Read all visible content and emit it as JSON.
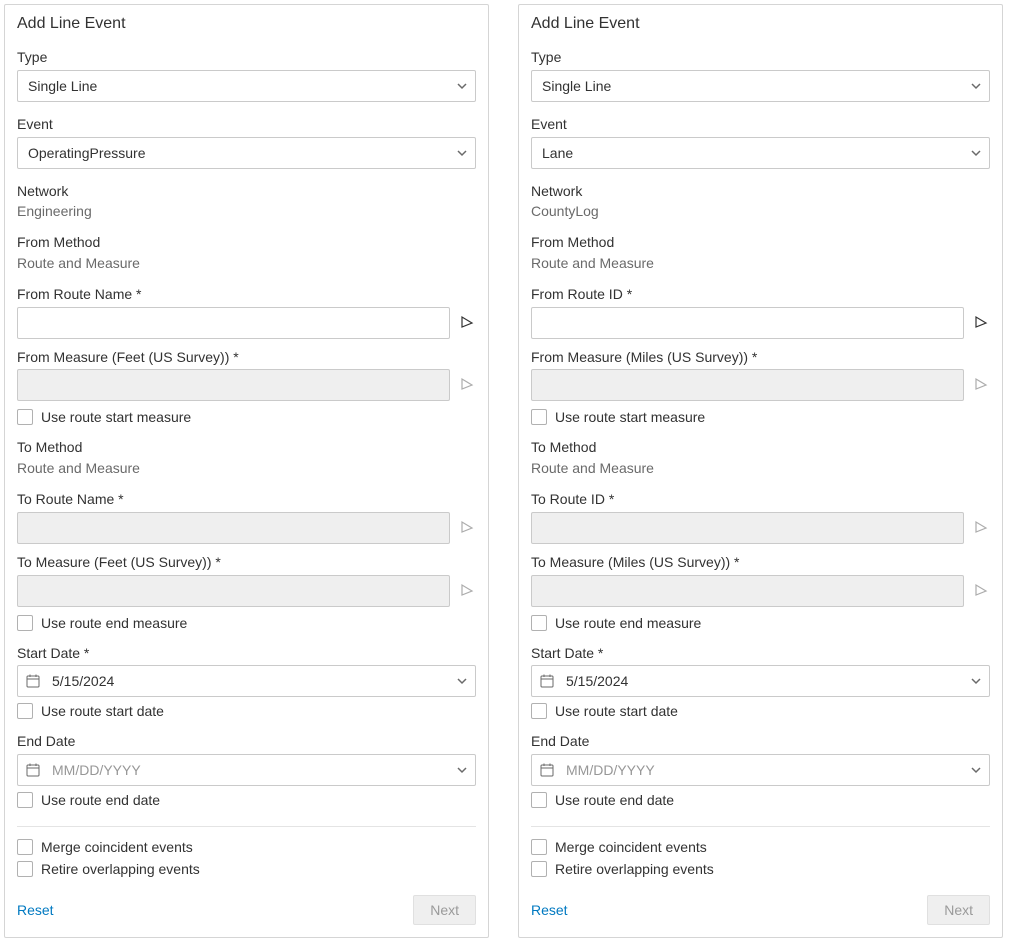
{
  "panels": [
    {
      "title": "Add Line Event",
      "type_label": "Type",
      "type_value": "Single Line",
      "event_label": "Event",
      "event_value": "OperatingPressure",
      "network_label": "Network",
      "network_value": "Engineering",
      "from_method_label": "From Method",
      "from_method_value": "Route and Measure",
      "from_route_label": "From Route Name *",
      "from_route_value": "",
      "from_measure_label": "From Measure (Feet (US Survey)) *",
      "from_measure_value": "",
      "use_route_start_measure_label": "Use route start measure",
      "to_method_label": "To Method",
      "to_method_value": "Route and Measure",
      "to_route_label": "To Route Name *",
      "to_route_value": "",
      "to_measure_label": "To Measure (Feet (US Survey)) *",
      "to_measure_value": "",
      "use_route_end_measure_label": "Use route end measure",
      "start_date_label": "Start Date *",
      "start_date_value": "5/15/2024",
      "use_route_start_date_label": "Use route start date",
      "end_date_label": "End Date",
      "end_date_placeholder": "MM/DD/YYYY",
      "use_route_end_date_label": "Use route end date",
      "merge_label": "Merge coincident events",
      "retire_label": "Retire overlapping events",
      "reset_label": "Reset",
      "next_label": "Next"
    },
    {
      "title": "Add Line Event",
      "type_label": "Type",
      "type_value": "Single Line",
      "event_label": "Event",
      "event_value": "Lane",
      "network_label": "Network",
      "network_value": "CountyLog",
      "from_method_label": "From Method",
      "from_method_value": "Route and Measure",
      "from_route_label": "From Route ID *",
      "from_route_value": "",
      "from_measure_label": "From Measure (Miles (US Survey)) *",
      "from_measure_value": "",
      "use_route_start_measure_label": "Use route start measure",
      "to_method_label": "To Method",
      "to_method_value": "Route and Measure",
      "to_route_label": "To Route ID *",
      "to_route_value": "",
      "to_measure_label": "To Measure (Miles (US Survey)) *",
      "to_measure_value": "",
      "use_route_end_measure_label": "Use route end measure",
      "start_date_label": "Start Date *",
      "start_date_value": "5/15/2024",
      "use_route_start_date_label": "Use route start date",
      "end_date_label": "End Date",
      "end_date_placeholder": "MM/DD/YYYY",
      "use_route_end_date_label": "Use route end date",
      "merge_label": "Merge coincident events",
      "retire_label": "Retire overlapping events",
      "reset_label": "Reset",
      "next_label": "Next"
    }
  ]
}
